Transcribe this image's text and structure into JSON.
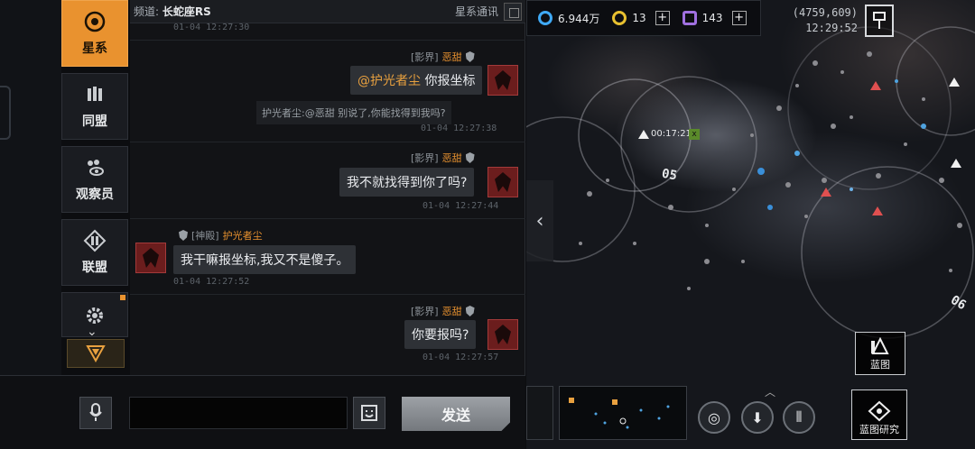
{
  "sidenav": {
    "items": [
      {
        "label": "星系",
        "icon": "galaxy-icon",
        "active": true
      },
      {
        "label": "同盟",
        "icon": "alliance-icon",
        "active": false
      },
      {
        "label": "观察员",
        "icon": "observer-icon",
        "active": false
      },
      {
        "label": "联盟",
        "icon": "league-icon",
        "active": false
      },
      {
        "label": "",
        "icon": "settings-icon",
        "active": false
      }
    ]
  },
  "chat": {
    "channel_prefix": "频道:",
    "channel_name": "长蛇座RS",
    "channel_type": "星系通讯",
    "first_timestamp": "01-04 12:27:30",
    "messages": [
      {
        "tag": "[影界]",
        "user": "恶甜",
        "mention": "@护光者尘",
        "text": " 你报坐标",
        "timestamp": ""
      },
      {
        "system": "护光者尘:@恶甜 别说了,你能找得到我吗?",
        "timestamp": "01-04 12:27:38"
      },
      {
        "tag": "[影界]",
        "user": "恶甜",
        "text": "我不就找得到你了吗?",
        "timestamp": "01-04 12:27:44"
      },
      {
        "tag": "[神殿]",
        "user": "护光者尘",
        "text": "我干嘛报坐标,我又不是傻子。",
        "timestamp": "01-04 12:27:52"
      },
      {
        "tag": "[影界]",
        "user": "恶甜",
        "text": "你要报吗?",
        "timestamp": "01-04 12:27:57"
      }
    ]
  },
  "input": {
    "value": "",
    "send_label": "发送"
  },
  "map": {
    "resources": [
      {
        "icon": "credits-icon",
        "value": "6.944万",
        "color": "#3fa9f5"
      },
      {
        "icon": "token-icon",
        "value": "13",
        "color": "#e8c030"
      },
      {
        "icon": "crystal-icon",
        "value": "143",
        "color": "#a070e0"
      }
    ],
    "coordinates": "(4759,609)",
    "clock": "12:29:52",
    "timer": "00:17:21",
    "zones": [
      "05",
      "06"
    ],
    "blueprint_label": "蓝图",
    "blueprint_research_label": "蓝图研究"
  }
}
